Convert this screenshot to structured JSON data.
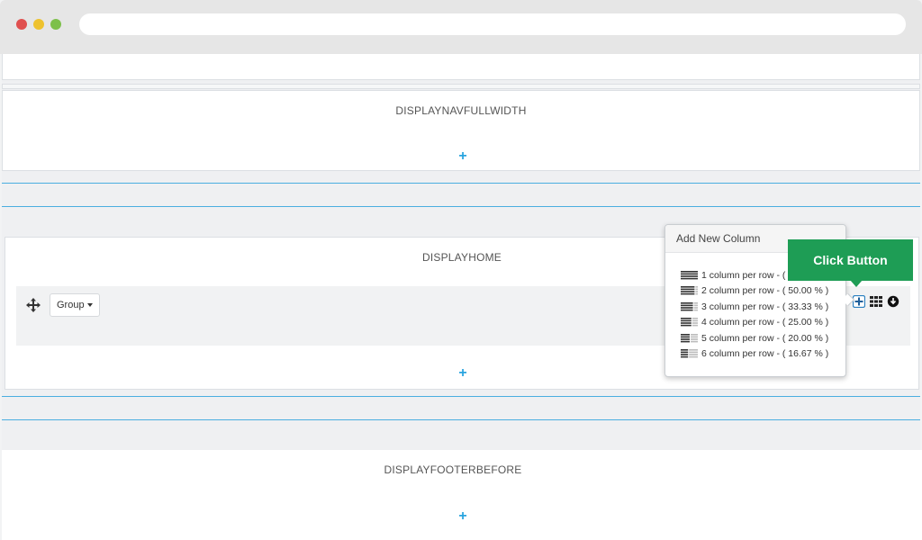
{
  "browser": {
    "url": ""
  },
  "hooks": [
    {
      "name": "DISPLAYNAVFULLWIDTH"
    },
    {
      "name": "DISPLAYHOME"
    },
    {
      "name": "DISPLAYFOOTERBEFORE"
    }
  ],
  "add_symbol": "+",
  "row": {
    "group_label": "Group"
  },
  "popover": {
    "title": "Add New Column",
    "options": [
      {
        "label": "1 column per row - (",
        "columns": 1
      },
      {
        "label": "2 column per row - ( 50.00 % )",
        "columns": 2
      },
      {
        "label": "3 column per row - ( 33.33 % )",
        "columns": 3
      },
      {
        "label": "4 column per row - ( 25.00 % )",
        "columns": 4
      },
      {
        "label": "5 column per row - ( 20.00 % )",
        "columns": 5
      },
      {
        "label": "6 column per row - ( 16.67 % )",
        "columns": 6
      }
    ]
  },
  "tooltip": {
    "text": "Click Button"
  },
  "icons": {
    "move": "move-arrows-icon",
    "add_column": "add-column-icon",
    "grid": "grid-icon",
    "download": "download-circle-icon",
    "caret": "caret-down-icon"
  },
  "colors": {
    "accent_blue": "#2aa4df",
    "tooltip_green": "#1e9d55",
    "window_red": "#e0504f",
    "window_yellow": "#eec22e",
    "window_green": "#7dc04a"
  }
}
